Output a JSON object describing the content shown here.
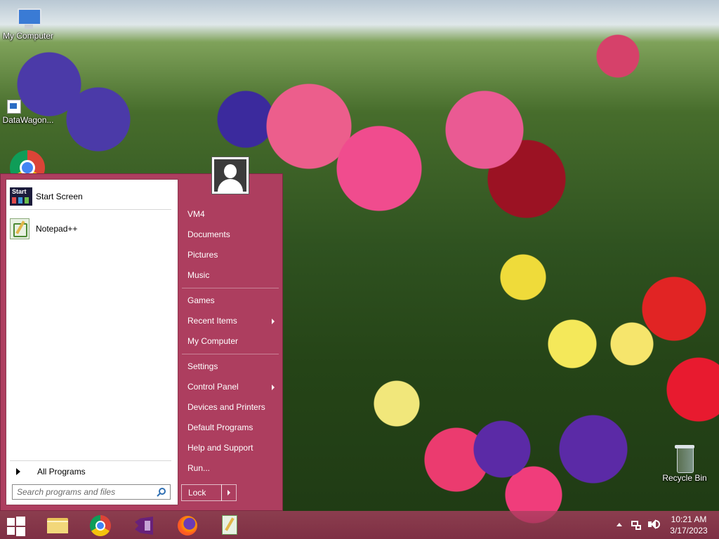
{
  "desktop": {
    "icons": [
      {
        "label": "My Computer",
        "icon": "computer-icon"
      },
      {
        "label": "DataWagon...",
        "icon": "shortcut-icon"
      },
      {
        "label": "Recycle Bin",
        "icon": "recycle-bin-icon"
      }
    ]
  },
  "start_menu": {
    "pinned": [
      {
        "label": "Start Screen",
        "icon": "start-screen-icon"
      },
      {
        "label": "Notepad++",
        "icon": "notepad-plus-plus-icon"
      }
    ],
    "all_programs": "All Programs",
    "search": {
      "placeholder": "Search programs and files"
    },
    "right_items": [
      {
        "label": "VM4"
      },
      {
        "label": "Documents"
      },
      {
        "label": "Pictures"
      },
      {
        "label": "Music"
      },
      {
        "label": "Games"
      },
      {
        "label": "Recent Items",
        "submenu": true
      },
      {
        "label": "My Computer"
      },
      {
        "label": "Settings"
      },
      {
        "label": "Control Panel",
        "submenu": true
      },
      {
        "label": "Devices and Printers"
      },
      {
        "label": "Default Programs"
      },
      {
        "label": "Help and Support"
      },
      {
        "label": "Run..."
      }
    ],
    "lock_label": "Lock"
  },
  "taskbar": {
    "apps": [
      "windows-start-icon",
      "file-explorer-icon",
      "chrome-icon",
      "visual-studio-icon",
      "firefox-icon",
      "notepad-plus-plus-icon"
    ],
    "clock": {
      "time": "10:21 AM",
      "date": "3/17/2023"
    }
  },
  "colors": {
    "start_menu_accent": "#ad3e5f",
    "taskbar": "#a53e62"
  }
}
